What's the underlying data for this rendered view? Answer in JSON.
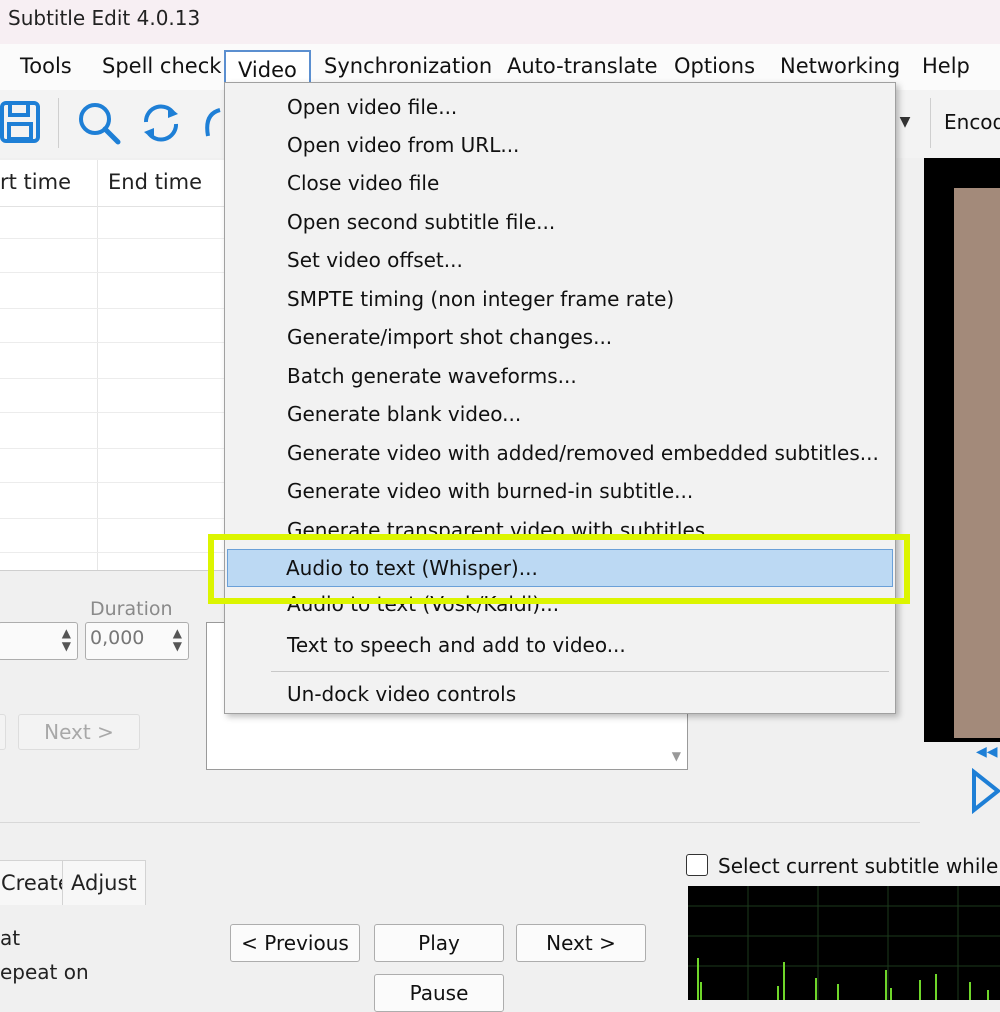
{
  "window": {
    "title": "Subtitle Edit 4.0.13"
  },
  "menubar": {
    "items": [
      "Tools",
      "Spell check",
      "Video",
      "Synchronization",
      "Auto-translate",
      "Options",
      "Networking",
      "Help"
    ],
    "active": "Video"
  },
  "toolbar": {
    "icons": [
      "save-icon",
      "search-icon",
      "refresh-icon"
    ],
    "encoding_label": "Encod"
  },
  "grid": {
    "columns": [
      "rt time",
      "End time"
    ]
  },
  "video_menu": {
    "items": [
      "Open video file...",
      "Open video from URL...",
      "Close video file",
      "Open second subtitle file...",
      "Set video offset...",
      "SMPTE timing (non integer frame rate)",
      "Generate/import shot changes...",
      "Batch generate waveforms...",
      "Generate blank video...",
      "Generate video with added/removed embedded subtitles...",
      "Generate video with burned-in subtitle...",
      "Generate transparent video with subtitles...",
      "Audio to text (Whisper)...",
      "Audio to text (Vosk/Kaldi)...",
      "Text to speech and add to video...",
      "Un-dock video controls"
    ],
    "highlighted": "Audio to text (Whisper)...",
    "highlight_color": "#dcf500"
  },
  "editor": {
    "duration_label": "Duration",
    "duration_value": "0,000",
    "next_label": "Next >"
  },
  "bottom": {
    "tabs": [
      "Create",
      "Adjust"
    ],
    "partial_labels": [
      "at",
      "epeat on"
    ],
    "buttons": {
      "previous": "< Previous",
      "play": "Play",
      "next": "Next >",
      "pause": "Pause"
    },
    "checkbox_label": "Select current subtitle while pla"
  },
  "colors": {
    "menu_highlight": "#bcd9f3",
    "callout": "#dcf500",
    "icon_blue": "#1e7fd6"
  }
}
